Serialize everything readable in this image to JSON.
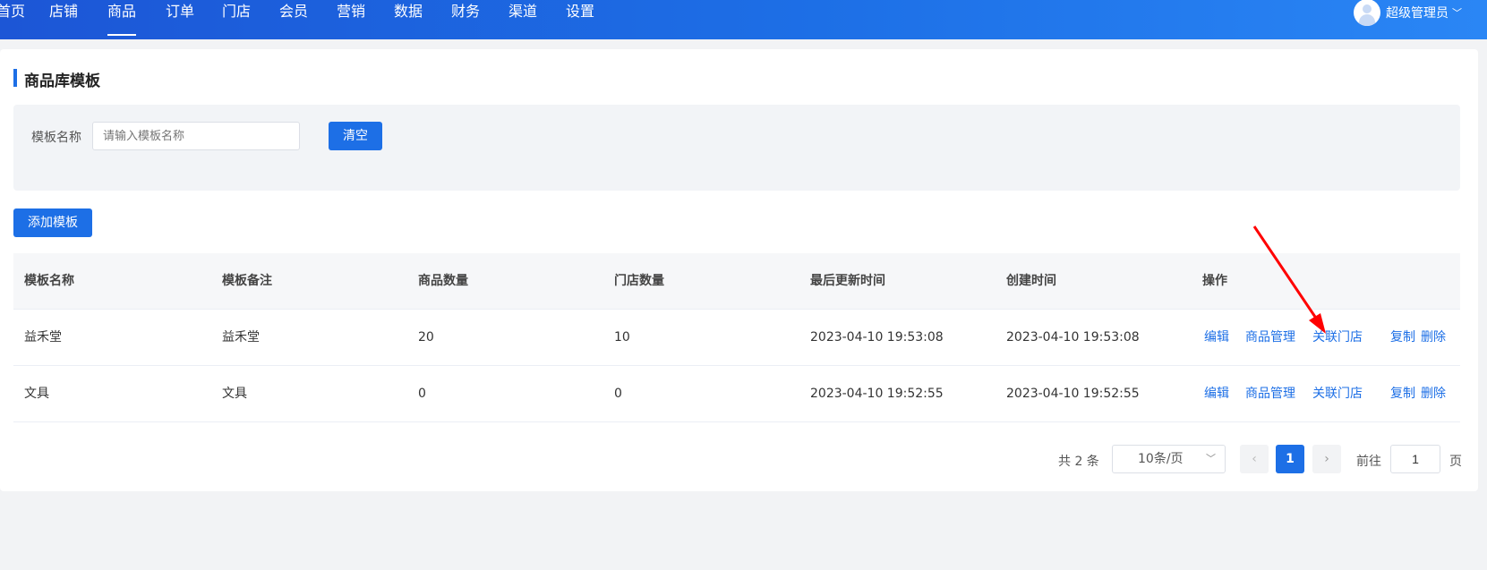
{
  "nav": {
    "items": [
      {
        "label": "首页"
      },
      {
        "label": "店铺"
      },
      {
        "label": "商品",
        "active": true
      },
      {
        "label": "订单"
      },
      {
        "label": "门店"
      },
      {
        "label": "会员"
      },
      {
        "label": "营销"
      },
      {
        "label": "数据"
      },
      {
        "label": "财务"
      },
      {
        "label": "渠道"
      },
      {
        "label": "设置"
      }
    ],
    "user_name": "超级管理员",
    "user_chevron": "﹀"
  },
  "page": {
    "title": "商品库模板"
  },
  "filter": {
    "name_label": "模板名称",
    "name_placeholder": "请输入模板名称",
    "clear_label": "清空"
  },
  "actions": {
    "add_label": "添加模板"
  },
  "table": {
    "columns": [
      "模板名称",
      "模板备注",
      "商品数量",
      "门店数量",
      "最后更新时间",
      "创建时间",
      "操作"
    ],
    "rows": [
      {
        "name": "益禾堂",
        "remark": "益禾堂",
        "goods_count": "20",
        "store_count": "10",
        "updated": "2023-04-10 19:53:08",
        "created": "2023-04-10 19:53:08"
      },
      {
        "name": "文具",
        "remark": "文具",
        "goods_count": "0",
        "store_count": "0",
        "updated": "2023-04-10 19:52:55",
        "created": "2023-04-10 19:52:55"
      }
    ],
    "ops": [
      "编辑",
      "商品管理",
      "关联门店",
      "复制",
      "删除"
    ]
  },
  "pagination": {
    "total": "共 2 条",
    "page_size": "10条/页",
    "prev": "‹",
    "current_page": "1",
    "next": "›",
    "goto_label": "前往",
    "goto_value": "1",
    "page_unit": "页"
  },
  "colors": {
    "accent": "#1d6fe6",
    "annotation_arrow": "#ff0000"
  }
}
